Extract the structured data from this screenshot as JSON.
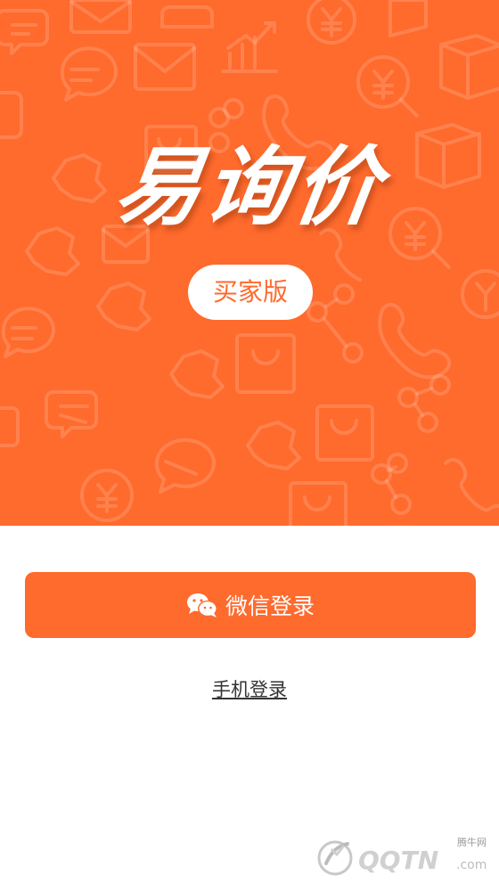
{
  "hero": {
    "background_color": "#ff6a2d",
    "app_title": "易询价",
    "edition_badge": "买家版"
  },
  "login": {
    "wechat_button_label": "微信登录",
    "phone_login_link": "手机登录"
  },
  "watermark": {
    "site_cn": "腾牛网",
    "logo_text": "QQTN",
    "suffix": ".com"
  },
  "colors": {
    "accent": "#ff6a2d",
    "button_text": "#ffffff",
    "link_text": "#333333"
  },
  "icons": {
    "wechat": "wechat-icon",
    "background_pattern": [
      "chat-bubble-icon",
      "mail-icon",
      "yen-search-icon",
      "chart-icon",
      "phone-icon",
      "package-icon",
      "shopping-bag-icon",
      "share-icon",
      "handshake-icon"
    ]
  }
}
